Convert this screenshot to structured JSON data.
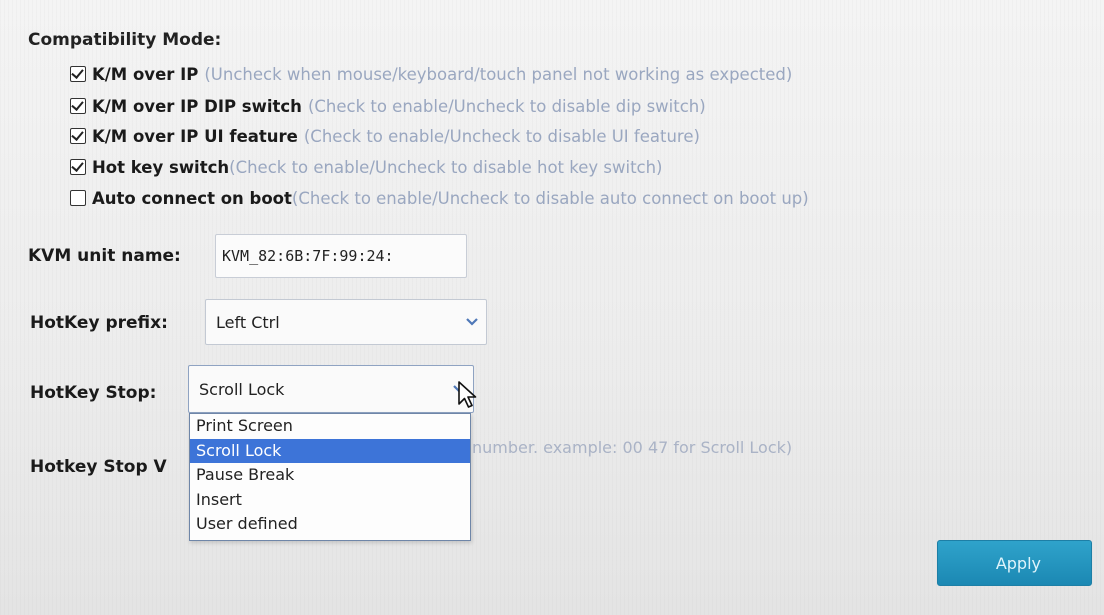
{
  "compatibility": {
    "title": "Compatibility Mode:",
    "options": [
      {
        "label": "K/M over IP",
        "hint": " (Uncheck when mouse/keyboard/touch panel not working as expected)",
        "checked": true
      },
      {
        "label": "K/M over IP DIP switch",
        "hint": " (Check to enable/Uncheck to disable dip switch)",
        "checked": true
      },
      {
        "label": "K/M over IP UI feature",
        "hint": " (Check to enable/Uncheck to disable UI feature)",
        "checked": true
      },
      {
        "label": "Hot key switch",
        "hint": "(Check to enable/Uncheck to disable hot key switch)",
        "checked": true
      },
      {
        "label": "Auto connect on boot",
        "hint": "(Check to enable/Uncheck to disable auto connect on boot up)",
        "checked": false
      }
    ]
  },
  "kvm_unit_name": {
    "label": "KVM unit name:",
    "value": "KVM_82:6B:7F:99:24:"
  },
  "hotkey_prefix": {
    "label": "HotKey prefix:",
    "value": "Left Ctrl"
  },
  "hotkey_stop": {
    "label": "HotKey Stop:",
    "value": "Scroll Lock",
    "options": [
      "Print Screen",
      "Scroll Lock",
      "Pause Break",
      "Insert",
      "User defined"
    ],
    "selected": "Scroll Lock"
  },
  "hotkey_stop_value": {
    "label": "Hotkey Stop V",
    "hint": "number. example: 00 47 for Scroll Lock)"
  },
  "apply": {
    "label": "Apply"
  },
  "colors": {
    "hint_text": "#9aa7c0",
    "selected_option_bg": "#3d74d8",
    "apply_button": "#1b88b3"
  }
}
